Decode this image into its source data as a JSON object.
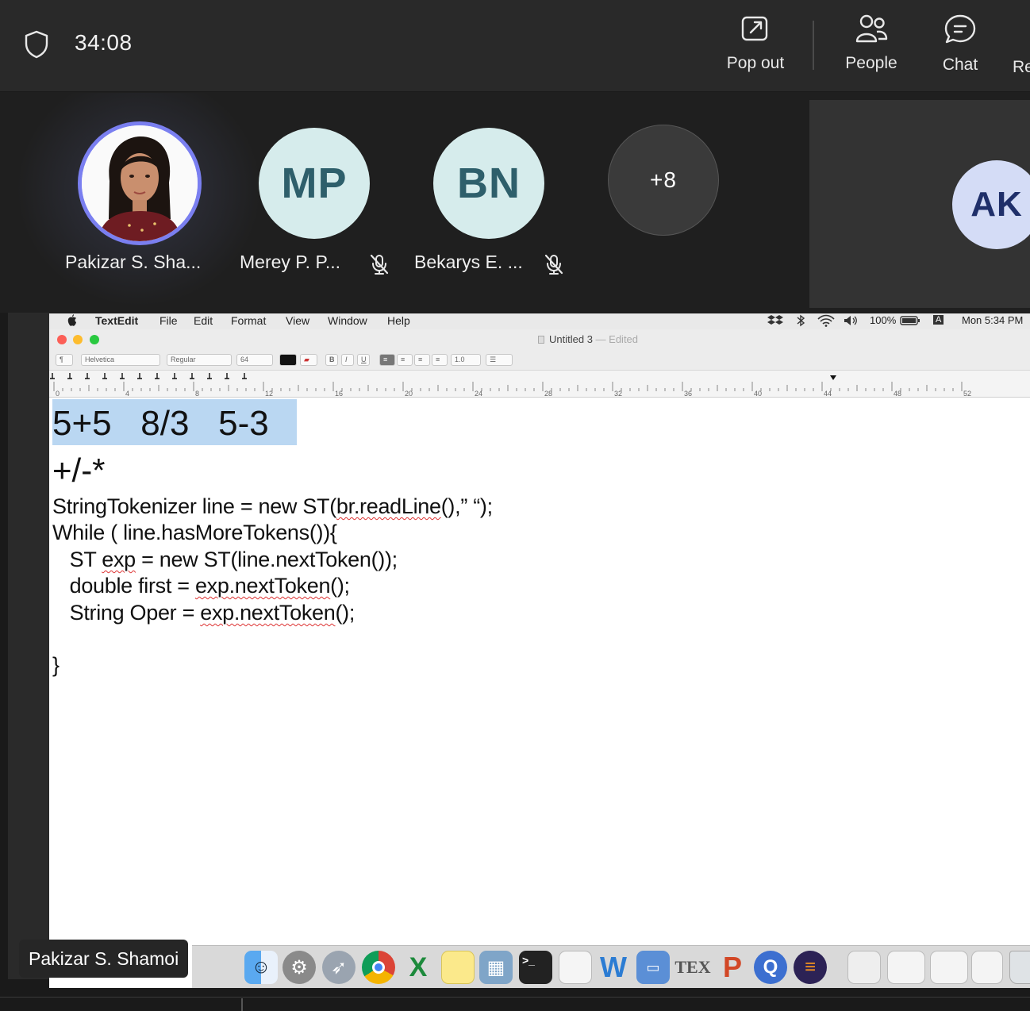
{
  "meeting": {
    "timer": "34:08",
    "shield_icon": "shield-icon",
    "toolbar": [
      {
        "label": "Pop out",
        "icon": "pop-out-icon"
      },
      {
        "label": "People",
        "icon": "people-icon"
      },
      {
        "label": "Chat",
        "icon": "chat-icon"
      },
      {
        "label": "Re",
        "icon": ""
      }
    ]
  },
  "participants": [
    {
      "name": "Pakizar S. Sha...",
      "initials": "",
      "photo": true,
      "muted": false
    },
    {
      "name": "Merey P. P...",
      "initials": "MP",
      "muted": true
    },
    {
      "name": "Bekarys E. ...",
      "initials": "BN",
      "muted": true
    },
    {
      "name": "",
      "initials": "+8",
      "muted": false
    }
  ],
  "side_tile": {
    "initials": "AK"
  },
  "presenter_label": "Pakizar S. Shamoi",
  "shared_screen": {
    "menubar": {
      "app": "TextEdit",
      "items": [
        "File",
        "Edit",
        "Format",
        "View",
        "Window",
        "Help"
      ],
      "battery": "100%",
      "input_source": "A",
      "clock": "Mon 5:34 PM"
    },
    "window": {
      "title": "Untitled 3",
      "edited": "— Edited"
    },
    "format_bar": {
      "paragraph": "¶",
      "font": "Helvetica",
      "style": "Regular",
      "size": "64",
      "bold": "B",
      "italic": "I",
      "underline": "U",
      "spacing": "1.0"
    },
    "ruler_labels": [
      "0",
      "4",
      "8",
      "12",
      "16",
      "20",
      "24",
      "28",
      "32",
      "36",
      "40",
      "44",
      "48",
      "52"
    ],
    "document": {
      "line1": "5+5   8/3   5-3",
      "line2": "+/-*",
      "code": [
        "StringTokenizer line = new ST(br.readLine(),” “);",
        "While ( line.hasMoreTokens()){",
        "   ST exp = new ST(line.nextToken());",
        "   double first = exp.nextToken();",
        "   String Oper = exp.nextToken();",
        "",
        "}"
      ]
    },
    "dock_icons": [
      "finder-icon",
      "system-preferences-icon",
      "launchpad-icon",
      "chrome-icon",
      "excel-icon",
      "notes-icon",
      "preview-icon",
      "terminal-icon",
      "textedit-icon",
      "word-icon",
      "keynote-icon",
      "tex-icon",
      "powerpoint-icon",
      "quicktime-icon",
      "eclipse-icon",
      "documents-icon",
      "screenshot-icon",
      "screenshot-icon",
      "screenshot-icon",
      "trash-icon"
    ]
  }
}
